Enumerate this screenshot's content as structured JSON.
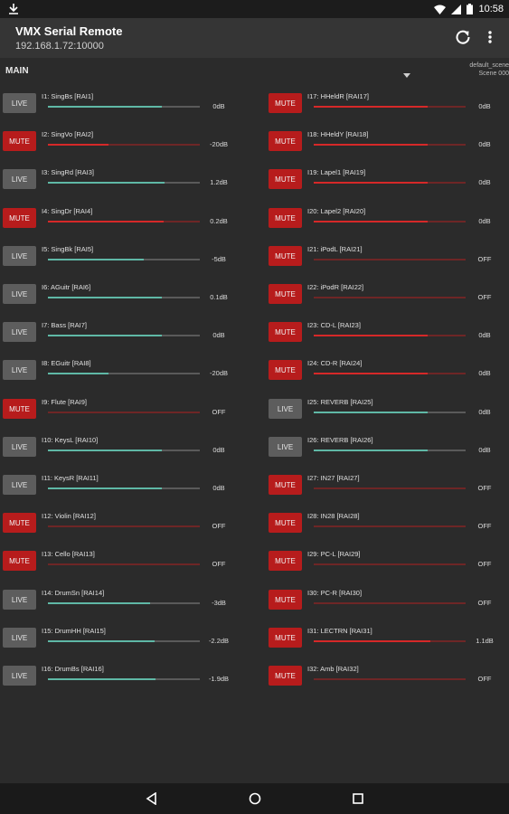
{
  "status_bar": {
    "time": "10:58",
    "notification_icon": "download-icon",
    "icons": [
      "wifi-icon",
      "signal-icon",
      "battery-icon"
    ]
  },
  "app": {
    "title": "VMX Serial Remote",
    "address": "192.168.1.72:10000"
  },
  "section": {
    "label": "MAIN"
  },
  "scene": {
    "name": "default_scene",
    "number": "Scene 000"
  },
  "colors": {
    "live_button": "#5d5d5d",
    "mute_button": "#b71c1c",
    "live_fader": "#5fb8a6",
    "mute_fader": "#d62828",
    "background": "#2b2b2b"
  },
  "channels_left": [
    {
      "name": "I1: SingBs  [RAI1]",
      "state": "LIVE",
      "level": "0dB",
      "fader": 0.75
    },
    {
      "name": "I2: SingVo  [RAI2]",
      "state": "MUTE",
      "level": "-20dB",
      "fader": 0.4
    },
    {
      "name": "I3: SingRd  [RAI3]",
      "state": "LIVE",
      "level": "1.2dB",
      "fader": 0.77
    },
    {
      "name": "I4: SingDr  [RAI4]",
      "state": "MUTE",
      "level": "0.2dB",
      "fader": 0.76
    },
    {
      "name": "I5: SingBk  [RAI5]",
      "state": "LIVE",
      "level": "-5dB",
      "fader": 0.63
    },
    {
      "name": "I6: AGuitr  [RAI6]",
      "state": "LIVE",
      "level": "0.1dB",
      "fader": 0.75
    },
    {
      "name": "I7: Bass  [RAI7]",
      "state": "LIVE",
      "level": "0dB",
      "fader": 0.75
    },
    {
      "name": "I8: EGuitr  [RAI8]",
      "state": "LIVE",
      "level": "-20dB",
      "fader": 0.4
    },
    {
      "name": "I9: Flute  [RAI9]",
      "state": "MUTE",
      "level": "OFF",
      "fader": 0.0
    },
    {
      "name": "I10: KeysL  [RAI10]",
      "state": "LIVE",
      "level": "0dB",
      "fader": 0.75
    },
    {
      "name": "I11: KeysR  [RAI11]",
      "state": "LIVE",
      "level": "0dB",
      "fader": 0.75
    },
    {
      "name": "I12: Violin  [RAI12]",
      "state": "MUTE",
      "level": "OFF",
      "fader": 0.0
    },
    {
      "name": "I13: Cello  [RAI13]",
      "state": "MUTE",
      "level": "OFF",
      "fader": 0.0
    },
    {
      "name": "I14: DrumSn  [RAI14]",
      "state": "LIVE",
      "level": "-3dB",
      "fader": 0.67
    },
    {
      "name": "I15: DrumHH  [RAI15]",
      "state": "LIVE",
      "level": "-2.2dB",
      "fader": 0.7
    },
    {
      "name": "I16: DrumBs  [RAI16]",
      "state": "LIVE",
      "level": "-1.9dB",
      "fader": 0.71
    }
  ],
  "channels_right": [
    {
      "name": "I17: HHeldR  [RAI17]",
      "state": "MUTE",
      "level": "0dB",
      "fader": 0.75
    },
    {
      "name": "I18: HHeldY  [RAI18]",
      "state": "MUTE",
      "level": "0dB",
      "fader": 0.75
    },
    {
      "name": "I19: Lapel1  [RAI19]",
      "state": "MUTE",
      "level": "0dB",
      "fader": 0.75
    },
    {
      "name": "I20: Lapel2  [RAI20]",
      "state": "MUTE",
      "level": "0dB",
      "fader": 0.75
    },
    {
      "name": "I21: iPodL  [RAI21]",
      "state": "MUTE",
      "level": "OFF",
      "fader": 0.0
    },
    {
      "name": "I22: iPodR  [RAI22]",
      "state": "MUTE",
      "level": "OFF",
      "fader": 0.0
    },
    {
      "name": "I23: CD-L  [RAI23]",
      "state": "MUTE",
      "level": "0dB",
      "fader": 0.75
    },
    {
      "name": "I24: CD-R  [RAI24]",
      "state": "MUTE",
      "level": "0dB",
      "fader": 0.75
    },
    {
      "name": "I25: REVERB  [RAI25]",
      "state": "LIVE",
      "level": "0dB",
      "fader": 0.75
    },
    {
      "name": "I26: REVERB  [RAI26]",
      "state": "LIVE",
      "level": "0dB",
      "fader": 0.75
    },
    {
      "name": "I27: IN27  [RAI27]",
      "state": "MUTE",
      "level": "OFF",
      "fader": 0.0
    },
    {
      "name": "I28: IN28  [RAI28]",
      "state": "MUTE",
      "level": "OFF",
      "fader": 0.0
    },
    {
      "name": "I29: PC-L  [RAI29]",
      "state": "MUTE",
      "level": "OFF",
      "fader": 0.0
    },
    {
      "name": "I30: PC-R  [RAI30]",
      "state": "MUTE",
      "level": "OFF",
      "fader": 0.0
    },
    {
      "name": "I31: LECTRN  [RAI31]",
      "state": "MUTE",
      "level": "1.1dB",
      "fader": 0.77
    },
    {
      "name": "I32: Amb  [RAI32]",
      "state": "MUTE",
      "level": "OFF",
      "fader": 0.0
    }
  ],
  "nav_bar": {
    "icons": [
      "back-icon",
      "home-icon",
      "recents-icon"
    ]
  }
}
